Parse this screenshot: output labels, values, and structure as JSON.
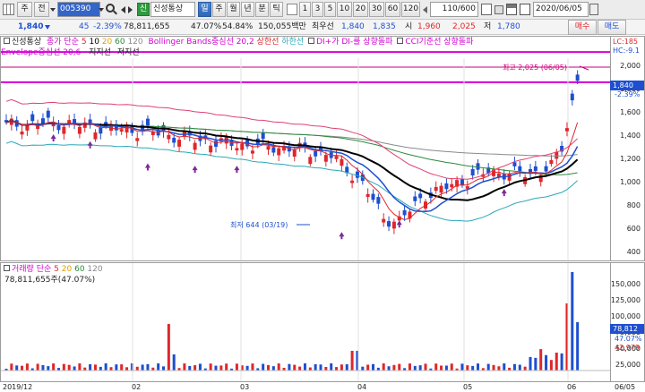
{
  "toolbar": {
    "mode_main": "주",
    "mode_prev": "전",
    "code": "005390",
    "sin_badge": "신",
    "stock_name": "신성통상",
    "period_active": "일",
    "periods": [
      "주",
      "월",
      "년",
      "분",
      "틱"
    ],
    "minutes": [
      "1",
      "3",
      "5",
      "10",
      "20",
      "30",
      "60",
      "120"
    ],
    "count": "110/600",
    "date": "2020/06/05",
    "buy_label": "매수",
    "sell_label": "매도"
  },
  "quote": {
    "price": "1,840",
    "change": "45",
    "change_pct": "-2.39%",
    "volume": "78,811,655",
    "ratio1": "47.07%",
    "ratio2": "54.84%",
    "amount": "150,055백만",
    "pref_label": "최우선",
    "pref_ask": "1,840",
    "pref_bid": "1,835",
    "high_label": "시",
    "open": "1,960",
    "high": "2,025",
    "low_label": "저",
    "low": "1,780"
  },
  "indicators": {
    "name": "신성통상",
    "ma_label": "종가 단순",
    "ma_periods": [
      "5",
      "10",
      "20",
      "60",
      "120"
    ],
    "bb": "Bollinger Bands중심선 20,2",
    "rising": "상한선",
    "falling": "하한선",
    "dmi": "DI+가 DI-를 상향돌파",
    "cci": "CCI기준선 상향돌파",
    "envelope": "Envelope중심선 20,6",
    "extra": "지지선",
    "extra2": "저지선",
    "lc": "LC:185",
    "hc": "HC:-9.1"
  },
  "annotations": {
    "high_note": "최고 2,025 (06/05)",
    "low_note": "최저 644 (03/19)",
    "price_badge": "1,840",
    "pct_badge": "-2.39%"
  },
  "volume_panel": {
    "label": "거래량",
    "ma_label": "단순",
    "ma_periods": [
      "5",
      "20",
      "60",
      "120"
    ],
    "value": "78,811,655주(47.07%)",
    "badge1": "78,812",
    "badge2": "47.07%",
    "badge3": "42,979"
  },
  "price_axis": [
    "2,000",
    "1,800",
    "1,600",
    "1,400",
    "1,200",
    "1,000",
    "800",
    "600",
    "400"
  ],
  "volume_axis": [
    "150,000",
    "125,000",
    "100,000",
    "75,000",
    "50,000",
    "25,000"
  ],
  "date_axis": [
    "2019/12",
    "02",
    "03",
    "04",
    "05",
    "06",
    "06/05"
  ],
  "colors": {
    "up": "#e0262a",
    "down": "#1d4fd0",
    "ma5": "#e0262a",
    "ma20": "#000000",
    "ma60": "#2c8a3c",
    "ma120": "#8a8a8a",
    "bb_upper": "#e04070",
    "bb_lower": "#2aa8b8",
    "limit_line": "#d400d4"
  }
}
